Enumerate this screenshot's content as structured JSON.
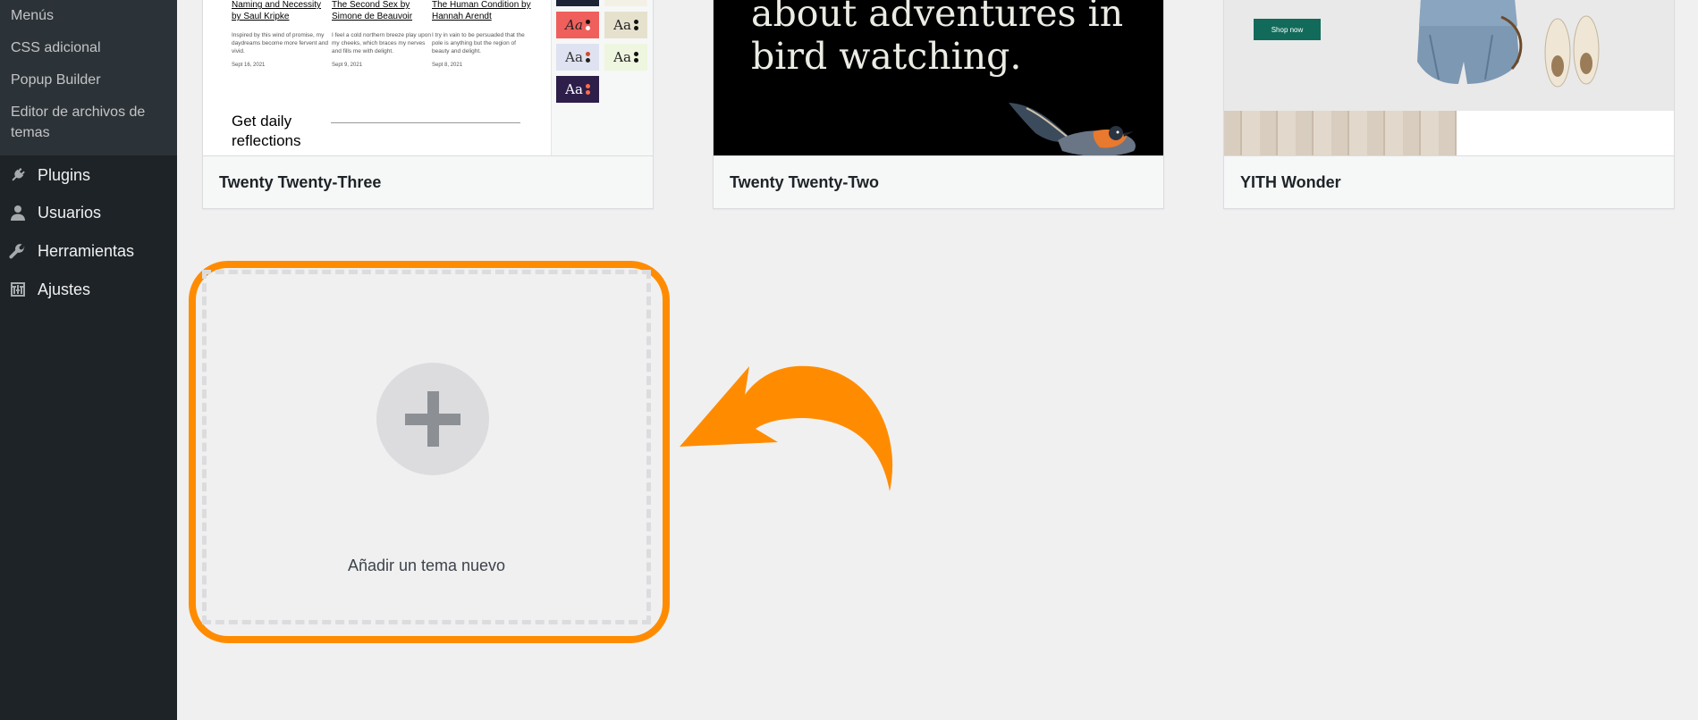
{
  "sidebar": {
    "submenu": [
      "Menús",
      "CSS adicional",
      "Popup Builder",
      "Editor de archivos de",
      "temas"
    ],
    "items": [
      {
        "label": "Plugins",
        "icon": "plug-icon"
      },
      {
        "label": "Usuarios",
        "icon": "user-icon"
      },
      {
        "label": "Herramientas",
        "icon": "wrench-icon"
      },
      {
        "label": "Ajustes",
        "icon": "settings-icon"
      }
    ]
  },
  "themes": [
    {
      "name": "Twenty Twenty-Three",
      "preview": {
        "posts": [
          {
            "title": "Naming and Necessity by Saul Kripke",
            "excerpt": "Inspired by this wind of promise, my daydreams become more fervent and vivid.",
            "date": "Sept 16, 2021"
          },
          {
            "title": "The Second Sex by Simone de Beauvoir",
            "excerpt": "I feel a cold northern breeze play upon my cheeks, which braces my nerves and fills me with delight.",
            "date": "Sept 9, 2021"
          },
          {
            "title": "The Human Condition by Hannah Arendt",
            "excerpt": "I try in vain to be persuaded that the pole is anything but the region of beauty and delight.",
            "date": "Sept 8, 2021"
          }
        ],
        "daily": "Get daily reflections",
        "swatch_label": "Aa"
      }
    },
    {
      "name": "Twenty Twenty-Two",
      "preview": {
        "line1": "about adventures in",
        "line2": "bird watching."
      }
    },
    {
      "name": "YITH Wonder",
      "preview": {
        "button": "Shop now"
      }
    }
  ],
  "add_theme": {
    "label": "Añadir un tema nuevo",
    "icon": "plus-icon"
  },
  "colors": {
    "highlight": "#ff8c00",
    "sidebar": "#1d2327",
    "background": "#f0f0f1"
  }
}
